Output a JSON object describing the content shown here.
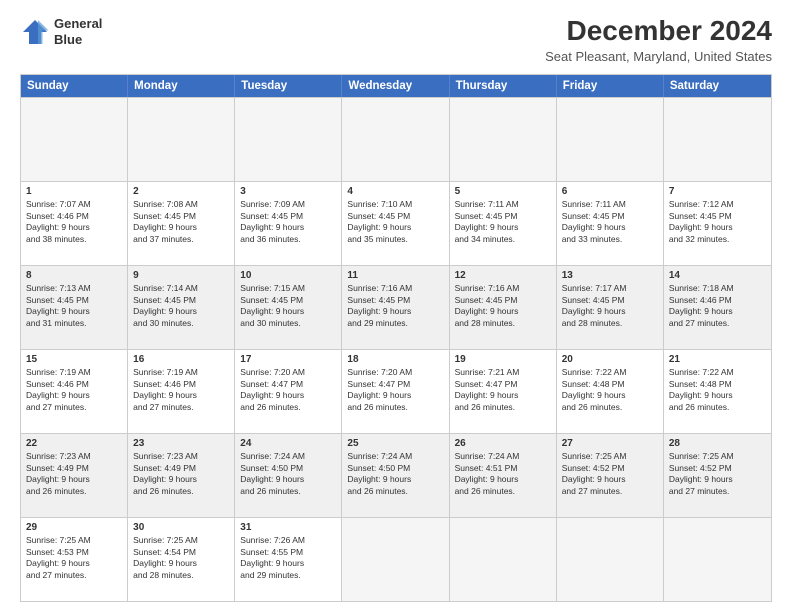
{
  "header": {
    "logo_line1": "General",
    "logo_line2": "Blue",
    "main_title": "December 2024",
    "subtitle": "Seat Pleasant, Maryland, United States"
  },
  "calendar": {
    "days_of_week": [
      "Sunday",
      "Monday",
      "Tuesday",
      "Wednesday",
      "Thursday",
      "Friday",
      "Saturday"
    ],
    "weeks": [
      [
        {
          "num": "",
          "empty": true
        },
        {
          "num": "",
          "empty": true
        },
        {
          "num": "",
          "empty": true
        },
        {
          "num": "",
          "empty": true
        },
        {
          "num": "",
          "empty": true
        },
        {
          "num": "",
          "empty": true
        },
        {
          "num": "",
          "empty": true
        }
      ],
      [
        {
          "num": "1",
          "lines": [
            "Sunrise: 7:07 AM",
            "Sunset: 4:46 PM",
            "Daylight: 9 hours",
            "and 38 minutes."
          ]
        },
        {
          "num": "2",
          "lines": [
            "Sunrise: 7:08 AM",
            "Sunset: 4:45 PM",
            "Daylight: 9 hours",
            "and 37 minutes."
          ]
        },
        {
          "num": "3",
          "lines": [
            "Sunrise: 7:09 AM",
            "Sunset: 4:45 PM",
            "Daylight: 9 hours",
            "and 36 minutes."
          ]
        },
        {
          "num": "4",
          "lines": [
            "Sunrise: 7:10 AM",
            "Sunset: 4:45 PM",
            "Daylight: 9 hours",
            "and 35 minutes."
          ]
        },
        {
          "num": "5",
          "lines": [
            "Sunrise: 7:11 AM",
            "Sunset: 4:45 PM",
            "Daylight: 9 hours",
            "and 34 minutes."
          ]
        },
        {
          "num": "6",
          "lines": [
            "Sunrise: 7:11 AM",
            "Sunset: 4:45 PM",
            "Daylight: 9 hours",
            "and 33 minutes."
          ]
        },
        {
          "num": "7",
          "lines": [
            "Sunrise: 7:12 AM",
            "Sunset: 4:45 PM",
            "Daylight: 9 hours",
            "and 32 minutes."
          ]
        }
      ],
      [
        {
          "num": "8",
          "lines": [
            "Sunrise: 7:13 AM",
            "Sunset: 4:45 PM",
            "Daylight: 9 hours",
            "and 31 minutes."
          ],
          "shaded": true
        },
        {
          "num": "9",
          "lines": [
            "Sunrise: 7:14 AM",
            "Sunset: 4:45 PM",
            "Daylight: 9 hours",
            "and 30 minutes."
          ],
          "shaded": true
        },
        {
          "num": "10",
          "lines": [
            "Sunrise: 7:15 AM",
            "Sunset: 4:45 PM",
            "Daylight: 9 hours",
            "and 30 minutes."
          ],
          "shaded": true
        },
        {
          "num": "11",
          "lines": [
            "Sunrise: 7:16 AM",
            "Sunset: 4:45 PM",
            "Daylight: 9 hours",
            "and 29 minutes."
          ],
          "shaded": true
        },
        {
          "num": "12",
          "lines": [
            "Sunrise: 7:16 AM",
            "Sunset: 4:45 PM",
            "Daylight: 9 hours",
            "and 28 minutes."
          ],
          "shaded": true
        },
        {
          "num": "13",
          "lines": [
            "Sunrise: 7:17 AM",
            "Sunset: 4:45 PM",
            "Daylight: 9 hours",
            "and 28 minutes."
          ],
          "shaded": true
        },
        {
          "num": "14",
          "lines": [
            "Sunrise: 7:18 AM",
            "Sunset: 4:46 PM",
            "Daylight: 9 hours",
            "and 27 minutes."
          ],
          "shaded": true
        }
      ],
      [
        {
          "num": "15",
          "lines": [
            "Sunrise: 7:19 AM",
            "Sunset: 4:46 PM",
            "Daylight: 9 hours",
            "and 27 minutes."
          ]
        },
        {
          "num": "16",
          "lines": [
            "Sunrise: 7:19 AM",
            "Sunset: 4:46 PM",
            "Daylight: 9 hours",
            "and 27 minutes."
          ]
        },
        {
          "num": "17",
          "lines": [
            "Sunrise: 7:20 AM",
            "Sunset: 4:47 PM",
            "Daylight: 9 hours",
            "and 26 minutes."
          ]
        },
        {
          "num": "18",
          "lines": [
            "Sunrise: 7:20 AM",
            "Sunset: 4:47 PM",
            "Daylight: 9 hours",
            "and 26 minutes."
          ]
        },
        {
          "num": "19",
          "lines": [
            "Sunrise: 7:21 AM",
            "Sunset: 4:47 PM",
            "Daylight: 9 hours",
            "and 26 minutes."
          ]
        },
        {
          "num": "20",
          "lines": [
            "Sunrise: 7:22 AM",
            "Sunset: 4:48 PM",
            "Daylight: 9 hours",
            "and 26 minutes."
          ]
        },
        {
          "num": "21",
          "lines": [
            "Sunrise: 7:22 AM",
            "Sunset: 4:48 PM",
            "Daylight: 9 hours",
            "and 26 minutes."
          ]
        }
      ],
      [
        {
          "num": "22",
          "lines": [
            "Sunrise: 7:23 AM",
            "Sunset: 4:49 PM",
            "Daylight: 9 hours",
            "and 26 minutes."
          ],
          "shaded": true
        },
        {
          "num": "23",
          "lines": [
            "Sunrise: 7:23 AM",
            "Sunset: 4:49 PM",
            "Daylight: 9 hours",
            "and 26 minutes."
          ],
          "shaded": true
        },
        {
          "num": "24",
          "lines": [
            "Sunrise: 7:24 AM",
            "Sunset: 4:50 PM",
            "Daylight: 9 hours",
            "and 26 minutes."
          ],
          "shaded": true
        },
        {
          "num": "25",
          "lines": [
            "Sunrise: 7:24 AM",
            "Sunset: 4:50 PM",
            "Daylight: 9 hours",
            "and 26 minutes."
          ],
          "shaded": true
        },
        {
          "num": "26",
          "lines": [
            "Sunrise: 7:24 AM",
            "Sunset: 4:51 PM",
            "Daylight: 9 hours",
            "and 26 minutes."
          ],
          "shaded": true
        },
        {
          "num": "27",
          "lines": [
            "Sunrise: 7:25 AM",
            "Sunset: 4:52 PM",
            "Daylight: 9 hours",
            "and 27 minutes."
          ],
          "shaded": true
        },
        {
          "num": "28",
          "lines": [
            "Sunrise: 7:25 AM",
            "Sunset: 4:52 PM",
            "Daylight: 9 hours",
            "and 27 minutes."
          ],
          "shaded": true
        }
      ],
      [
        {
          "num": "29",
          "lines": [
            "Sunrise: 7:25 AM",
            "Sunset: 4:53 PM",
            "Daylight: 9 hours",
            "and 27 minutes."
          ]
        },
        {
          "num": "30",
          "lines": [
            "Sunrise: 7:25 AM",
            "Sunset: 4:54 PM",
            "Daylight: 9 hours",
            "and 28 minutes."
          ]
        },
        {
          "num": "31",
          "lines": [
            "Sunrise: 7:26 AM",
            "Sunset: 4:55 PM",
            "Daylight: 9 hours",
            "and 29 minutes."
          ]
        },
        {
          "num": "",
          "empty": true
        },
        {
          "num": "",
          "empty": true
        },
        {
          "num": "",
          "empty": true
        },
        {
          "num": "",
          "empty": true
        }
      ]
    ]
  }
}
